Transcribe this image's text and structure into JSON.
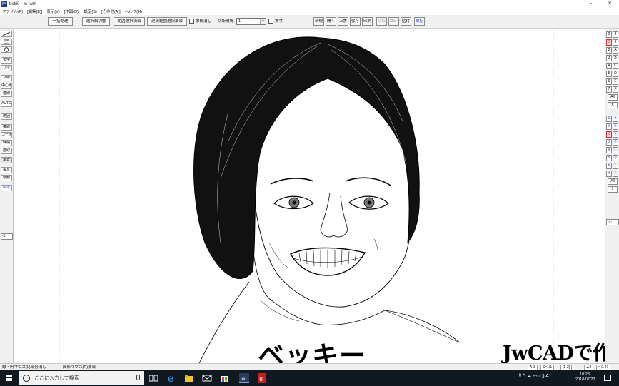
{
  "window": {
    "title": "beki0 - jw_win",
    "icon_label": "jw",
    "controls": [
      "–",
      "▫",
      "✕"
    ]
  },
  "menu": [
    "ファイル(F)",
    "[編集(E)]",
    "表示(V)",
    "[作図(D)]",
    "設定(S)",
    "[その他(A)]",
    "ヘルプ(H)"
  ],
  "toolbar": {
    "batch": "一括処理",
    "select_toggle": "選択順切替",
    "range_erase": "範囲選択消去",
    "continuous_erase": "連続範囲選択消去",
    "node_label": "節間消し",
    "cut_label": "切断間隔",
    "cut_value": "1",
    "actual_label": "実寸",
    "new": "新規",
    "open": "開く",
    "overwrite": "上書",
    "save": "保存",
    "print": "印刷",
    "cut": "切取",
    "copy": "コピー",
    "paste": "貼付",
    "redraw": "線記"
  },
  "left_tools": {
    "line_icon": "line-tool-icon",
    "rect_icon": "rect-tool-icon",
    "circle_icon": "circle-tool-icon",
    "text": "文字",
    "dim": "寸法",
    "double_line": "２線",
    "center_line": "中心線",
    "connect": "連線",
    "auto": "AUTO",
    "range": "範囲",
    "multi_line": "複線",
    "corner": "コーナー",
    "stretch": "伸縮",
    "chamfer": "面取",
    "erase": "消去",
    "copy": "複写",
    "move": "移動",
    "undo": "戻る",
    "step": "-1-"
  },
  "right_layers": {
    "groups_top": [
      [
        "0",
        "8"
      ],
      [
        "1",
        "9"
      ],
      [
        "2",
        "A"
      ],
      [
        "3",
        "B"
      ],
      [
        "4",
        "C"
      ],
      [
        "5",
        "D"
      ],
      [
        "6",
        "E"
      ],
      [
        "7",
        "F"
      ]
    ],
    "all_top": "All",
    "x_top": "✕",
    "groups_bottom": [
      [
        "0",
        "⑧"
      ],
      [
        "①",
        "⑨"
      ],
      [
        "②",
        "Ⓐ"
      ],
      [
        "③",
        "Ⓑ"
      ],
      [
        "④",
        "Ⓒ"
      ],
      [
        "⑤",
        "Ⓓ"
      ],
      [
        "⑥",
        "Ⓔ"
      ],
      [
        "⑦",
        "Ⓕ"
      ]
    ],
    "all_bottom": "All",
    "one_bottom": "1",
    "step": "-1-"
  },
  "canvas": {
    "caption": "ベッキー",
    "watermark": "JwCADで作図"
  },
  "status": {
    "left": "線・円マウス(L)部分消し",
    "right_hint": "図形マウス(R)消去",
    "paper": "A-3",
    "scale": "S=1/1",
    "layer": "[1-2]",
    "angle": "∠0",
    "zoom": "× 0.47"
  },
  "taskbar": {
    "search_placeholder": "ここに入力して検索",
    "time": "10:28",
    "date": "2018/07/23",
    "tray_text": "ᴿ  ^  ☁  ▭  ◁)  A"
  },
  "colors": {
    "accent": "#1a3ccc",
    "layer_selected": "#c43a3a",
    "taskbar": "#101820"
  }
}
